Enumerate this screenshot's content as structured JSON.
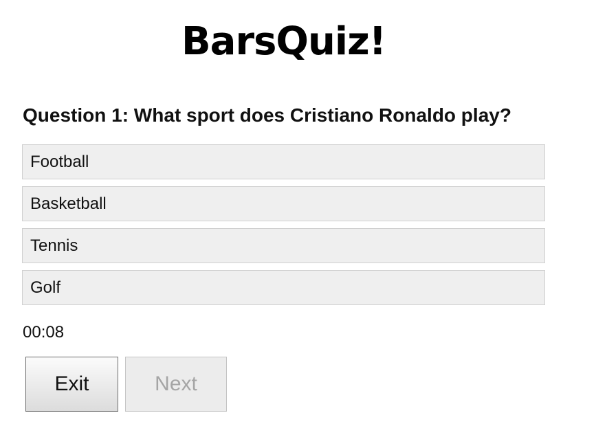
{
  "app": {
    "logo_text": "BarsQuiz!"
  },
  "quiz": {
    "question": "Question 1: What sport does Cristiano Ronaldo play?",
    "answers": [
      {
        "label": "Football"
      },
      {
        "label": "Basketball"
      },
      {
        "label": "Tennis"
      },
      {
        "label": "Golf"
      }
    ],
    "timer": "00:08"
  },
  "controls": {
    "exit_label": "Exit",
    "next_label": "Next",
    "next_enabled": false
  },
  "colors": {
    "answer_background": "#efefef",
    "answer_border": "#d0d0d0",
    "disabled_text": "#a5a5a5"
  }
}
